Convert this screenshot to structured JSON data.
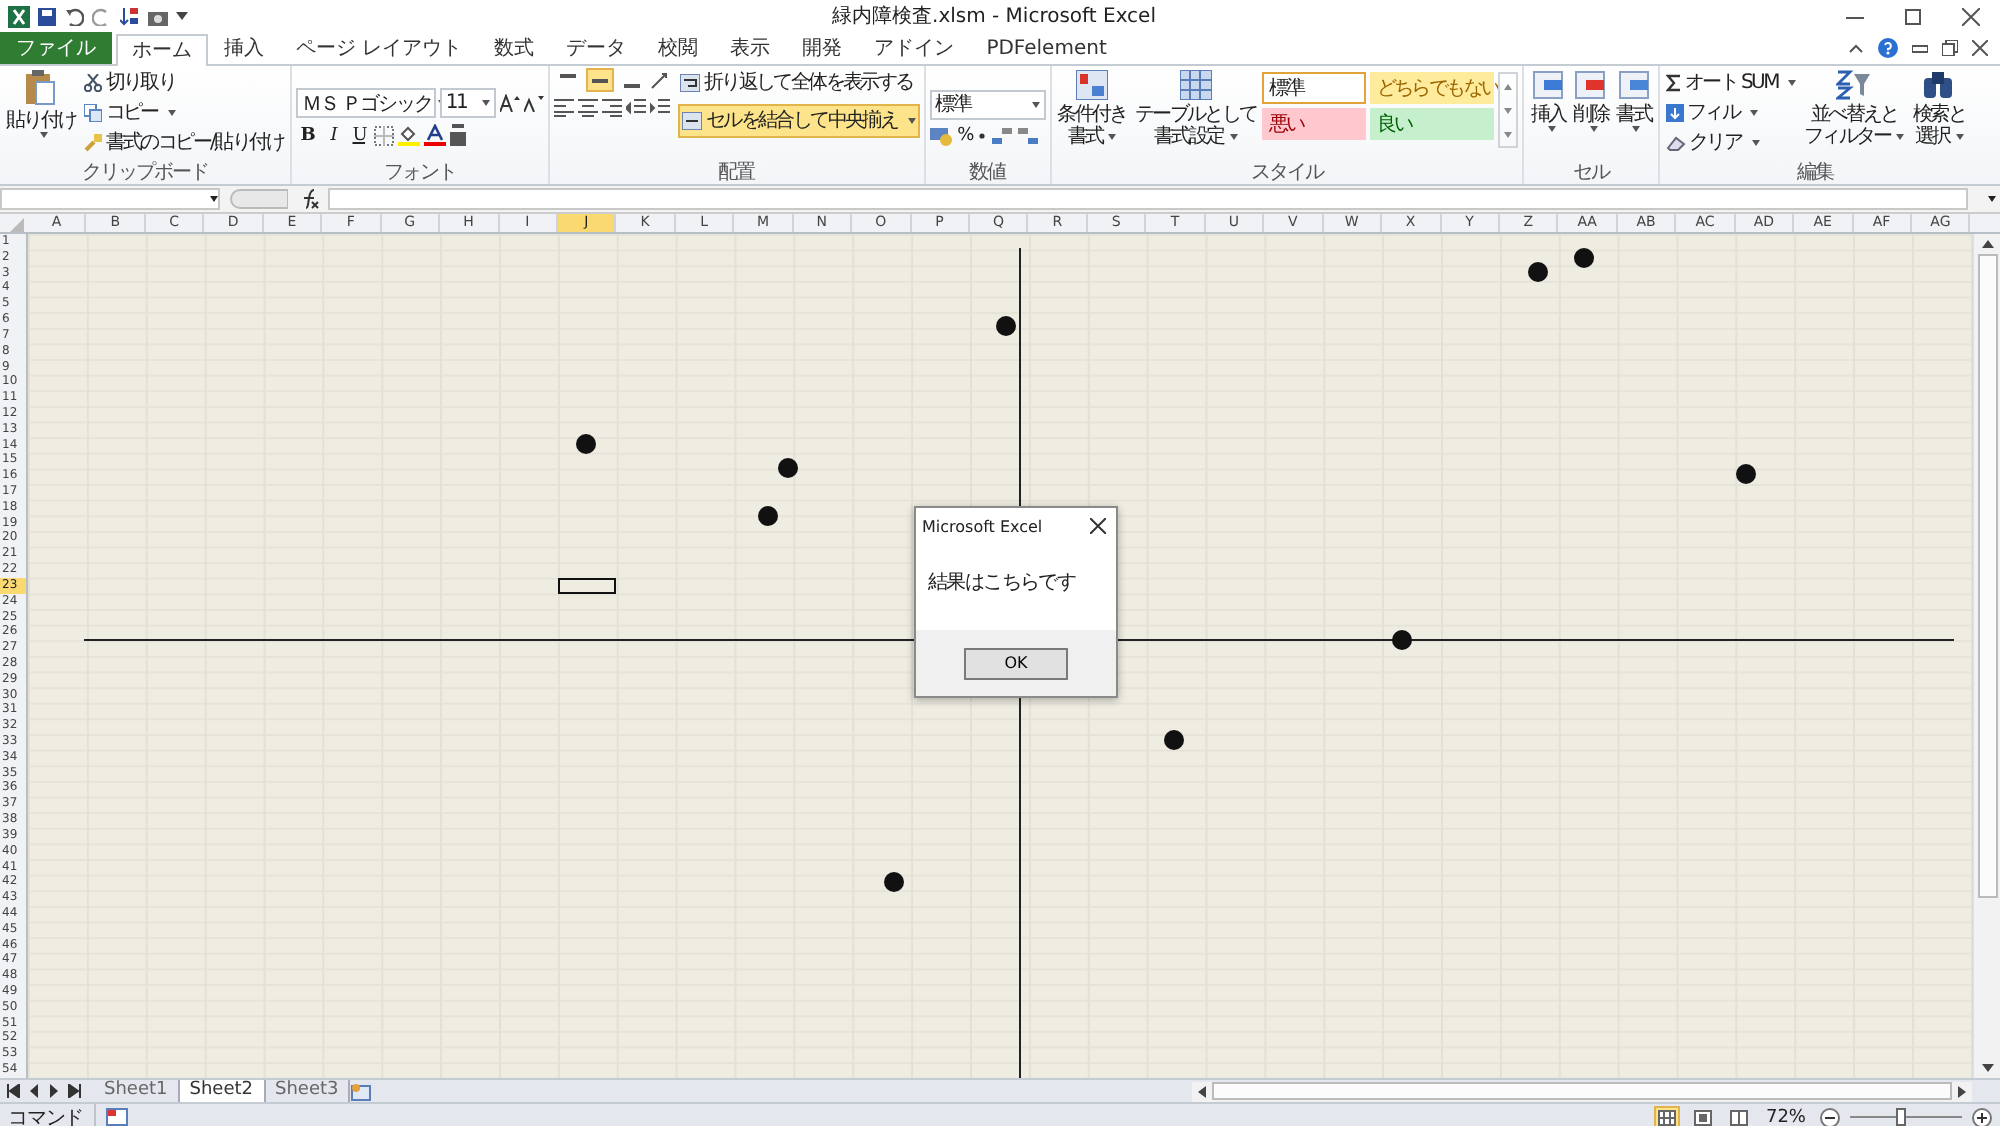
{
  "title_bar": {
    "title": "緑内障検査.xlsm - Microsoft Excel"
  },
  "tabs": [
    {
      "label": "ファイル",
      "kind": "file",
      "selected": false
    },
    {
      "label": "ホーム",
      "kind": "tab",
      "selected": true
    },
    {
      "label": "挿入",
      "kind": "tab",
      "selected": false
    },
    {
      "label": "ページ レイアウト",
      "kind": "tab",
      "selected": false
    },
    {
      "label": "数式",
      "kind": "tab",
      "selected": false
    },
    {
      "label": "データ",
      "kind": "tab",
      "selected": false
    },
    {
      "label": "校閲",
      "kind": "tab",
      "selected": false
    },
    {
      "label": "表示",
      "kind": "tab",
      "selected": false
    },
    {
      "label": "開発",
      "kind": "tab",
      "selected": false
    },
    {
      "label": "アドイン",
      "kind": "tab",
      "selected": false
    },
    {
      "label": "PDFelement",
      "kind": "tab",
      "selected": false
    }
  ],
  "ribbon": {
    "clipboard": {
      "label": "クリップボード",
      "paste": "貼り付け",
      "cut": "切り取り",
      "copy": "コピー",
      "format_painter": "書式のコピー/貼り付け"
    },
    "font": {
      "label": "フォント",
      "font_name": "ＭＳ Ｐゴシック",
      "font_size": "11",
      "bold": "B",
      "italic": "I",
      "underline": "U"
    },
    "alignment": {
      "label": "配置",
      "vertical": [
        {
          "on": false
        },
        {
          "on": true
        },
        {
          "on": false
        }
      ],
      "wrap_text": "折り返して全体を表示する",
      "merge_center": {
        "label": "セルを結合して中央揃え",
        "on": true
      }
    },
    "number": {
      "label": "数値",
      "format": "標準",
      "percent": "%"
    },
    "styles": {
      "label": "スタイル",
      "conditional_formatting": [
        "条件付き",
        "書式"
      ],
      "format_as_table": [
        "テーブルとして",
        "書式設定"
      ],
      "cell_styles": [
        {
          "label": "標準",
          "kind": "normal",
          "selected": true
        },
        {
          "label": "どちらでもない",
          "kind": "neutral",
          "selected": false
        },
        {
          "label": "悪い",
          "kind": "bad",
          "selected": false
        },
        {
          "label": "良い",
          "kind": "good",
          "selected": false
        }
      ]
    },
    "cells": {
      "label": "セル",
      "buttons": [
        {
          "label": "挿入",
          "kind": "insert"
        },
        {
          "label": "削除",
          "kind": "delete"
        },
        {
          "label": "書式",
          "kind": "format"
        }
      ]
    },
    "editing": {
      "label": "編集",
      "autosum": "オート SUM",
      "fill": "フィル",
      "clear": "クリア",
      "sort_filter": [
        "並べ替えと",
        "フィルター"
      ],
      "find_select": [
        "検索と",
        "選択"
      ]
    }
  },
  "sheet": {
    "columns": [
      {
        "label": "A",
        "selected": false
      },
      {
        "label": "B",
        "selected": false
      },
      {
        "label": "C",
        "selected": false
      },
      {
        "label": "D",
        "selected": false
      },
      {
        "label": "E",
        "selected": false
      },
      {
        "label": "F",
        "selected": false
      },
      {
        "label": "G",
        "selected": false
      },
      {
        "label": "H",
        "selected": false
      },
      {
        "label": "I",
        "selected": false
      },
      {
        "label": "J",
        "selected": true
      },
      {
        "label": "K",
        "selected": false
      },
      {
        "label": "L",
        "selected": false
      },
      {
        "label": "M",
        "selected": false
      },
      {
        "label": "N",
        "selected": false
      },
      {
        "label": "O",
        "selected": false
      },
      {
        "label": "P",
        "selected": false
      },
      {
        "label": "Q",
        "selected": false
      },
      {
        "label": "R",
        "selected": false
      },
      {
        "label": "S",
        "selected": false
      },
      {
        "label": "T",
        "selected": false
      },
      {
        "label": "U",
        "selected": false
      },
      {
        "label": "V",
        "selected": false
      },
      {
        "label": "W",
        "selected": false
      },
      {
        "label": "X",
        "selected": false
      },
      {
        "label": "Y",
        "selected": false
      },
      {
        "label": "Z",
        "selected": false
      },
      {
        "label": "AA",
        "selected": false
      },
      {
        "label": "AB",
        "selected": false
      },
      {
        "label": "AC",
        "selected": false
      },
      {
        "label": "AD",
        "selected": false
      },
      {
        "label": "AE",
        "selected": false
      },
      {
        "label": "AF",
        "selected": false
      },
      {
        "label": "AG",
        "selected": false
      }
    ],
    "rows": [
      {
        "label": "1",
        "selected": false
      },
      {
        "label": "2",
        "selected": false
      },
      {
        "label": "3",
        "selected": false
      },
      {
        "label": "4",
        "selected": false
      },
      {
        "label": "5",
        "selected": false
      },
      {
        "label": "6",
        "selected": false
      },
      {
        "label": "7",
        "selected": false
      },
      {
        "label": "8",
        "selected": false
      },
      {
        "label": "9",
        "selected": false
      },
      {
        "label": "10",
        "selected": false
      },
      {
        "label": "11",
        "selected": false
      },
      {
        "label": "12",
        "selected": false
      },
      {
        "label": "13",
        "selected": false
      },
      {
        "label": "14",
        "selected": false
      },
      {
        "label": "15",
        "selected": false
      },
      {
        "label": "16",
        "selected": false
      },
      {
        "label": "17",
        "selected": false
      },
      {
        "label": "18",
        "selected": false
      },
      {
        "label": "19",
        "selected": false
      },
      {
        "label": "20",
        "selected": false
      },
      {
        "label": "21",
        "selected": false
      },
      {
        "label": "22",
        "selected": false
      },
      {
        "label": "23",
        "selected": true
      },
      {
        "label": "24",
        "selected": false
      },
      {
        "label": "25",
        "selected": false
      },
      {
        "label": "26",
        "selected": false
      },
      {
        "label": "27",
        "selected": false
      },
      {
        "label": "28",
        "selected": false
      },
      {
        "label": "29",
        "selected": false
      },
      {
        "label": "30",
        "selected": false
      },
      {
        "label": "31",
        "selected": false
      },
      {
        "label": "32",
        "selected": false
      },
      {
        "label": "33",
        "selected": false
      },
      {
        "label": "34",
        "selected": false
      },
      {
        "label": "35",
        "selected": false
      },
      {
        "label": "36",
        "selected": false
      },
      {
        "label": "37",
        "selected": false
      },
      {
        "label": "38",
        "selected": false
      },
      {
        "label": "39",
        "selected": false
      },
      {
        "label": "40",
        "selected": false
      },
      {
        "label": "41",
        "selected": false
      },
      {
        "label": "42",
        "selected": false
      },
      {
        "label": "43",
        "selected": false
      },
      {
        "label": "44",
        "selected": false
      },
      {
        "label": "45",
        "selected": false
      },
      {
        "label": "46",
        "selected": false
      },
      {
        "label": "47",
        "selected": false
      },
      {
        "label": "48",
        "selected": false
      },
      {
        "label": "49",
        "selected": false
      },
      {
        "label": "50",
        "selected": false
      },
      {
        "label": "51",
        "selected": false
      },
      {
        "label": "52",
        "selected": false
      },
      {
        "label": "53",
        "selected": false
      },
      {
        "label": "54",
        "selected": false
      }
    ]
  },
  "dialog": {
    "title": "Microsoft Excel",
    "message": "結果はこちらです",
    "button": "OK"
  },
  "sheet_tabs": [
    {
      "label": "Sheet1",
      "selected": false
    },
    {
      "label": "Sheet2",
      "selected": true
    },
    {
      "label": "Sheet3",
      "selected": false
    }
  ],
  "status_bar": {
    "mode": "コマンド",
    "views": [
      {
        "selected": true
      },
      {
        "selected": false
      },
      {
        "selected": false
      }
    ],
    "zoom": "72%",
    "zoom_slider": {
      "level": 0.45
    }
  }
}
